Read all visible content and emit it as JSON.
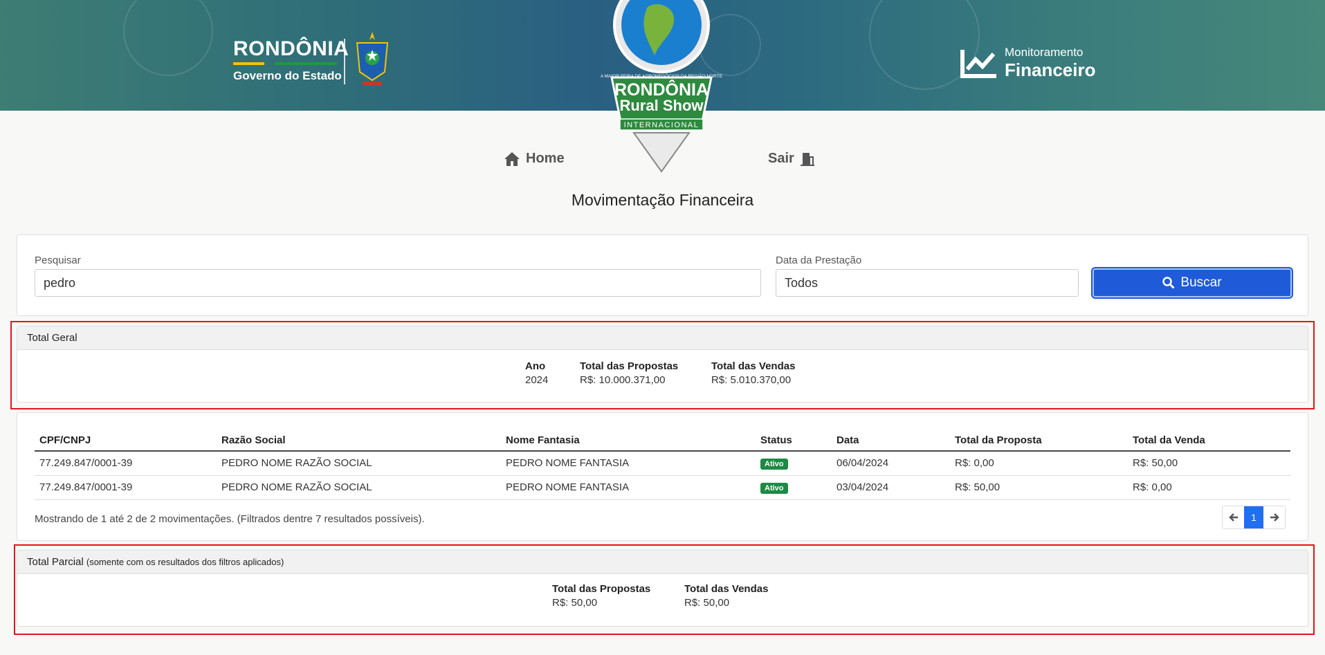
{
  "header": {
    "gov_name": "RONDÔNIA",
    "gov_sub": "Governo do Estado",
    "show_top": "A MAIOR FEIRA DE AGRONEGÓCIOS DA REGIÃO NORTE",
    "show_name_1": "RONDÔNIA",
    "show_name_2": "Rural Show",
    "show_badge": "INTERNACIONAL",
    "monitor_label": "Monitoramento",
    "monitor_title": "Financeiro"
  },
  "nav": {
    "home": "Home",
    "logout": "Sair"
  },
  "page_title": "Movimentação Financeira",
  "filters": {
    "search_label": "Pesquisar",
    "search_value": "pedro",
    "date_label": "Data da Prestação",
    "date_value": "Todos",
    "search_button": "Buscar"
  },
  "total_geral": {
    "title": "Total Geral",
    "ano_label": "Ano",
    "ano_value": "2024",
    "propostas_label": "Total das Propostas",
    "propostas_value": "R$: 10.000.371,00",
    "vendas_label": "Total das Vendas",
    "vendas_value": "R$: 5.010.370,00"
  },
  "table": {
    "headers": [
      "CPF/CNPJ",
      "Razão Social",
      "Nome Fantasia",
      "Status",
      "Data",
      "Total da Proposta",
      "Total da Venda"
    ],
    "rows": [
      [
        "77.249.847/0001-39",
        "PEDRO NOME RAZÃO SOCIAL",
        "PEDRO NOME FANTASIA",
        "Ativo",
        "06/04/2024",
        "R$: 0,00",
        "R$: 50,00"
      ],
      [
        "77.249.847/0001-39",
        "PEDRO NOME RAZÃO SOCIAL",
        "PEDRO NOME FANTASIA",
        "Ativo",
        "03/04/2024",
        "R$: 50,00",
        "R$: 0,00"
      ]
    ],
    "showing_text": "Mostrando de 1 até 2 de 2 movimentações. (Filtrados dentre 7 resultados possíveis).",
    "current_page": "1"
  },
  "total_parcial": {
    "title": "Total Parcial",
    "subtitle": "(somente com os resultados dos filtros aplicados)",
    "propostas_label": "Total das Propostas",
    "propostas_value": "R$: 50,00",
    "vendas_label": "Total das Vendas",
    "vendas_value": "R$: 50,00"
  },
  "colors": {
    "primary": "#1f5bd8",
    "badge": "#1c8a45",
    "highlight": "#e3141b"
  }
}
